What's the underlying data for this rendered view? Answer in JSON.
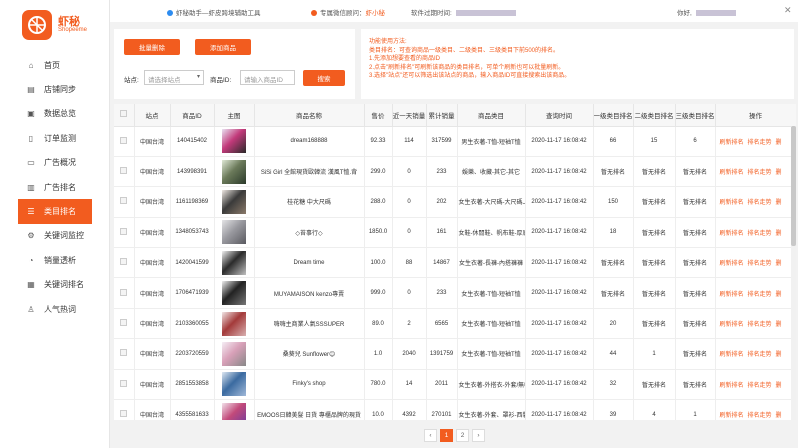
{
  "brand": {
    "name": "虾秘",
    "sub": "Shopeeme",
    "color": "#f25c1f"
  },
  "topbar": {
    "helper": "虾秘助手—虾皮跨境辅助工具",
    "service_label": "专属微信顾问：",
    "service_name": "虾小秘",
    "expire_label": "软件过期时间:",
    "hello": "你好,",
    "close": "✕"
  },
  "sidebar": {
    "items": [
      {
        "label": "首页",
        "icon": "home-icon",
        "glyph": "⌂"
      },
      {
        "label": "店铺同步",
        "icon": "shop-icon",
        "glyph": "▤"
      },
      {
        "label": "数据总览",
        "icon": "monitor-icon",
        "glyph": "▣"
      },
      {
        "label": "订单监测",
        "icon": "order-icon",
        "glyph": "▯"
      },
      {
        "label": "广告概况",
        "icon": "ad-icon",
        "glyph": "▭"
      },
      {
        "label": "广告排名",
        "icon": "bar-chart-icon",
        "glyph": "▥"
      },
      {
        "label": "类目排名",
        "icon": "list-icon",
        "glyph": "☰"
      },
      {
        "label": "关键词监控",
        "icon": "gear-icon",
        "glyph": "⚙"
      },
      {
        "label": "销量透析",
        "icon": "pie-icon",
        "glyph": "◔"
      },
      {
        "label": "关键词排名",
        "icon": "keyword-icon",
        "glyph": "▦"
      },
      {
        "label": "人气热词",
        "icon": "user-icon",
        "glyph": "♙"
      }
    ]
  },
  "controls": {
    "batch_delete": "批量删除",
    "add_product": "添加商品",
    "site_label": "站点:",
    "site_placeholder": "请选择站点",
    "product_id_label": "商品ID:",
    "product_id_placeholder": "请输入商品ID",
    "search": "搜索"
  },
  "instructions": [
    "功能使用方法:",
    "类目排名：可查询商品一级类目、二级类目、三级类目下前500的排名。",
    "1.先添加想要查看的商品ID",
    "2.点击\"刷新排名\"可刷新该商品的类目排名，可单个刷新也可以批量刷新。",
    "3.选择\"站点\"还可以筛选出该站点的商品，输入商品ID可直接搜索出该商品。"
  ],
  "table": {
    "headers": [
      "",
      "站点",
      "商品ID",
      "主图",
      "商品名称",
      "售价",
      "近一天销量",
      "累计销量",
      "商品类目",
      "查询时间",
      "一级类目排名",
      "二级类目排名",
      "三级类目排名",
      "操作"
    ],
    "actions": [
      "刷新排名",
      "排名走势",
      "删"
    ],
    "rows": [
      {
        "site": "中国台湾",
        "id": "140415402",
        "name": "dream168888",
        "price": "92.33",
        "day": "114",
        "total": "317599",
        "cat": "男生衣著-T恤-短袖T恤",
        "time": "2020-11-17 16:08:42",
        "r1": "66",
        "r2": "15",
        "r3": "6"
      },
      {
        "site": "中国台湾",
        "id": "143998391",
        "name": "SiSi Girl 全館現貨歐韓流 漢風T恤.背",
        "price": "299.0",
        "day": "0",
        "total": "233",
        "cat": "娛樂、收藏-其它-其它",
        "time": "2020-11-17 16:08:42",
        "r1": "暂无排名",
        "r2": "暂无排名",
        "r3": "暂无排名"
      },
      {
        "site": "中国台湾",
        "id": "1161198369",
        "name": "桂花糖 中大尺碼",
        "price": "288.0",
        "day": "0",
        "total": "202",
        "cat": "女生衣著-大尺碼-大尺碼上衣",
        "time": "2020-11-17 16:08:42",
        "r1": "150",
        "r2": "暂无排名",
        "r3": "暂无排名"
      },
      {
        "site": "中国台湾",
        "id": "1348053743",
        "name": "◇苔事行◇",
        "price": "1850.0",
        "day": "0",
        "total": "161",
        "cat": "女鞋-休閒鞋、帆布鞋-厚底鞋",
        "time": "2020-11-17 16:08:42",
        "r1": "18",
        "r2": "暂无排名",
        "r3": "暂无排名"
      },
      {
        "site": "中国台湾",
        "id": "1420041599",
        "name": "Dream time",
        "price": "100.0",
        "day": "88",
        "total": "14867",
        "cat": "女生衣著-長褲-內搭褲褲",
        "time": "2020-11-17 16:08:42",
        "r1": "暂无排名",
        "r2": "暂无排名",
        "r3": "暂无排名"
      },
      {
        "site": "中国台湾",
        "id": "1706471939",
        "name": "MUYAMAISON kenzo專賣",
        "price": "999.0",
        "day": "0",
        "total": "233",
        "cat": "女生衣著-T恤-短袖T恤",
        "time": "2020-11-17 16:08:42",
        "r1": "暂无排名",
        "r2": "暂无排名",
        "r3": "暂无排名"
      },
      {
        "site": "中国台湾",
        "id": "2103360055",
        "name": "嗨嗨主商業人氣SSSUPER",
        "price": "89.0",
        "day": "2",
        "total": "6565",
        "cat": "女生衣著-T恤-短袖T恤",
        "time": "2020-11-17 16:08:42",
        "r1": "20",
        "r2": "暂无排名",
        "r3": "暂无排名"
      },
      {
        "site": "中国台湾",
        "id": "2203720559",
        "name": "桑葵兒 Sunflower😊",
        "price": "1.0",
        "day": "2040",
        "total": "1391759",
        "cat": "女生衣著-T恤-短袖T恤",
        "time": "2020-11-17 16:08:42",
        "r1": "44",
        "r2": "1",
        "r3": "暂无排名"
      },
      {
        "site": "中国台湾",
        "id": "2851553858",
        "name": "Finky's shop",
        "price": "780.0",
        "day": "14",
        "total": "2011",
        "cat": "女生衣著-外搭衣-外套/無帽",
        "time": "2020-11-17 16:08:42",
        "r1": "32",
        "r2": "暂无排名",
        "r3": "暂无排名"
      },
      {
        "site": "中国台湾",
        "id": "4355581633",
        "name": "EMOOS日韓美髮 日貨 專櫃品牌的現貨",
        "price": "10.0",
        "day": "4392",
        "total": "270101",
        "cat": "女生衣著-外套、罩衫-西裝外",
        "time": "2020-11-17 16:08:42",
        "r1": "39",
        "r2": "4",
        "r3": "1"
      }
    ]
  },
  "pagination": {
    "prev": "‹",
    "pages": [
      "1",
      "2"
    ],
    "next": "›"
  }
}
